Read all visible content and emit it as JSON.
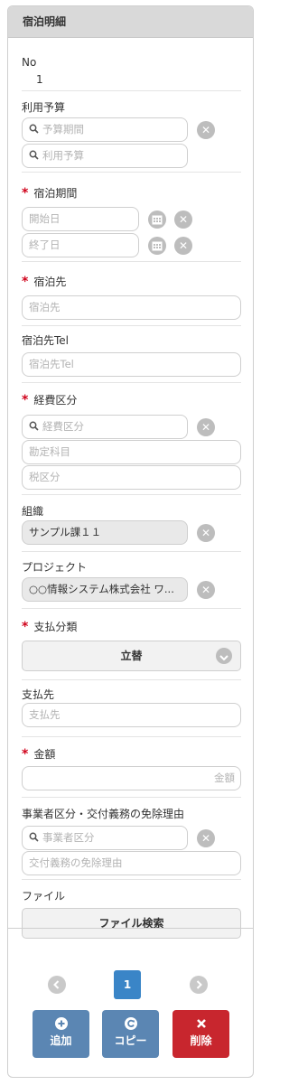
{
  "panel": {
    "title": "宿泊明細"
  },
  "no": {
    "label": "No",
    "value": "1"
  },
  "budget": {
    "label": "利用予算",
    "period_placeholder": "予算期間",
    "budget_placeholder": "利用予算"
  },
  "stay_period": {
    "label": "宿泊期間",
    "required": "*",
    "start_placeholder": "開始日",
    "end_placeholder": "終了日"
  },
  "destination": {
    "label": "宿泊先",
    "required": "*",
    "placeholder": "宿泊先"
  },
  "destination_tel": {
    "label": "宿泊先Tel",
    "placeholder": "宿泊先Tel"
  },
  "expense_category": {
    "label": "経費区分",
    "required": "*",
    "category_placeholder": "経費区分",
    "account_placeholder": "勘定科目",
    "tax_placeholder": "税区分"
  },
  "organization": {
    "label": "組織",
    "value": "サンプル課１１"
  },
  "project": {
    "label": "プロジェクト",
    "value": "○○情報システム株式会社 ワ..."
  },
  "payment_type": {
    "label": "支払分類",
    "required": "*",
    "selected": "立替"
  },
  "payee": {
    "label": "支払先",
    "placeholder": "支払先"
  },
  "amount": {
    "label": "金額",
    "required": "*",
    "placeholder": "金額"
  },
  "business": {
    "label": "事業者区分・交付義務の免除理由",
    "category_placeholder": "事業者区分",
    "exemption_placeholder": "交付義務の免除理由"
  },
  "file": {
    "label": "ファイル",
    "button": "ファイル検索"
  },
  "pagination": {
    "current": "1"
  },
  "actions": {
    "add": "追加",
    "copy": "コピー",
    "delete": "削除"
  },
  "colors": {
    "accent": "#3a85c7",
    "add": "#5b86b3",
    "copy": "#5b86b3",
    "delete": "#c8262e",
    "required": "#d0021b"
  },
  "icons": {
    "search": "search-icon",
    "clear": "close-circle-icon",
    "calendar": "calendar-icon",
    "chevron": "chevron-down-icon",
    "prev": "chevron-left-icon",
    "next": "chevron-right-icon",
    "add": "plus-icon",
    "copy": "refresh-icon",
    "delete": "close-icon"
  }
}
